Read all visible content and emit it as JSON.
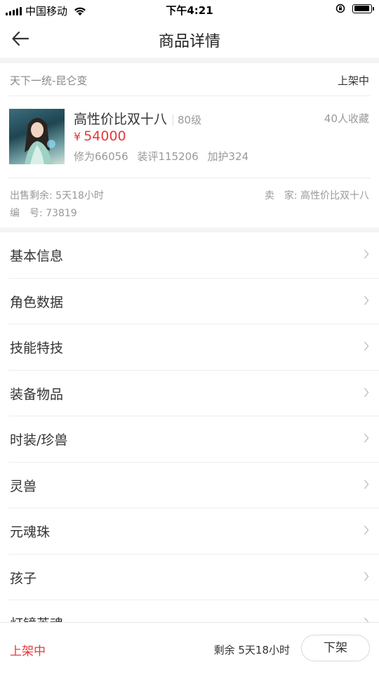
{
  "status_bar": {
    "carrier": "中国移动",
    "time": "下午4:21"
  },
  "nav": {
    "title": "商品详情"
  },
  "item": {
    "server": "天下一统-昆仑变",
    "state": "上架中",
    "name": "高性价比双十八",
    "level": "80级",
    "favorites": "40人收藏",
    "currency": "¥",
    "price": "54000",
    "stats": [
      "修为66056",
      "装评115206",
      "加护324"
    ],
    "remaining": "出售剩余: 5天18小时",
    "seller": "卖　家: 高性价比双十八",
    "serial": "编　号: 73819"
  },
  "menu": [
    {
      "label": "基本信息"
    },
    {
      "label": "角色数据"
    },
    {
      "label": "技能特技"
    },
    {
      "label": "装备物品"
    },
    {
      "label": "时装/珍兽"
    },
    {
      "label": "灵兽"
    },
    {
      "label": "元魂珠"
    },
    {
      "label": "孩子"
    },
    {
      "label": "灯镜英魂"
    }
  ],
  "bottom": {
    "status": "上架中",
    "remaining": "剩余 5天18小时",
    "button": "下架"
  },
  "colors": {
    "accent": "#e4393c",
    "muted": "#999999"
  }
}
